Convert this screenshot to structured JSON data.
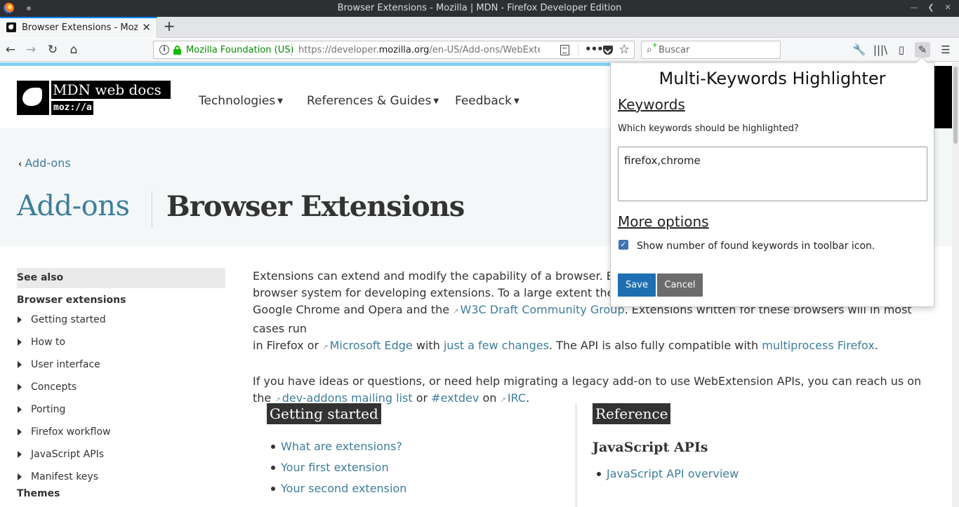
{
  "os": {
    "window_title": "Browser Extensions - Mozilla | MDN - Firefox Developer Edition"
  },
  "tab": {
    "title": "Browser Extensions - Mozilla | MDN",
    "close": "✕",
    "new_tab": "+"
  },
  "nav": {
    "site_identity": "Mozilla Foundation (US)",
    "url_prefix": "https://developer.",
    "url_domain": "mozilla.org",
    "url_path": "/en-US/Add-ons/WebExtensions",
    "more": "•••",
    "search_placeholder": "Buscar"
  },
  "mdn": {
    "logo_text": "MDN web docs",
    "logo_sub": "moz://a",
    "menu": [
      "Technologies",
      "References & Guides",
      "Feedback"
    ]
  },
  "hero": {
    "breadcrumb": "Add-ons",
    "title_left": "Add-ons",
    "title_right": "Browser Extensions"
  },
  "sidebar": {
    "see_also": "See also",
    "group": "Browser extensions",
    "items": [
      "Getting started",
      "How to",
      "User interface",
      "Concepts",
      "Porting",
      "Firefox workflow",
      "JavaScript APIs",
      "Manifest keys"
    ],
    "themes": "Themes"
  },
  "article": {
    "p1_a": "Extensions can extend and modify the capability of a browser. Exter",
    "p1_b": "browser system for developing extensions. To a large extent the sys",
    "p1_c1": "Google Chrome and Opera and the ",
    "p1_link_w3c": "W3C Draft Community Group",
    "p1_c2": ". Extensions written for these browsers will in most cases run",
    "p1_d1": "in Firefox or ",
    "p1_link_edge": "Microsoft Edge",
    "p1_d2": " with ",
    "p1_link_changes": "just a few changes",
    "p1_d3": ". The API is also fully compatible with ",
    "p1_link_multi": "multiprocess Firefox",
    "p1_d4": ".",
    "p2_a": "If you have ideas or questions, or need help migrating a legacy add-on to use WebExtension APIs, you can reach us on the ",
    "p2_link_dev": "dev-addons mailing list",
    "p2_or": " or ",
    "p2_link_extdev": "#extdev",
    "p2_on": " on ",
    "p2_link_irc": "IRC",
    "p2_end": "."
  },
  "getting_started": {
    "heading": "Getting started",
    "links": [
      "What are extensions?",
      "Your first extension",
      "Your second extension"
    ]
  },
  "reference": {
    "heading": "Reference",
    "subheading": "JavaScript APIs",
    "links": [
      "JavaScript API overview"
    ]
  },
  "popup": {
    "title": "Multi-Keywords Highlighter",
    "keywords_heading": "Keywords",
    "question": "Which keywords should be highlighted?",
    "keywords_value": "firefox,chrome",
    "more_options_heading": "More options",
    "checkbox_label": "Show number of found keywords in toolbar icon.",
    "checkbox_checked": true,
    "save_label": "Save",
    "cancel_label": "Cancel"
  },
  "colors": {
    "link": "#3d7e9a",
    "save": "#1d6fb1",
    "cancel": "#6c6c6c",
    "secure": "#058b00"
  }
}
